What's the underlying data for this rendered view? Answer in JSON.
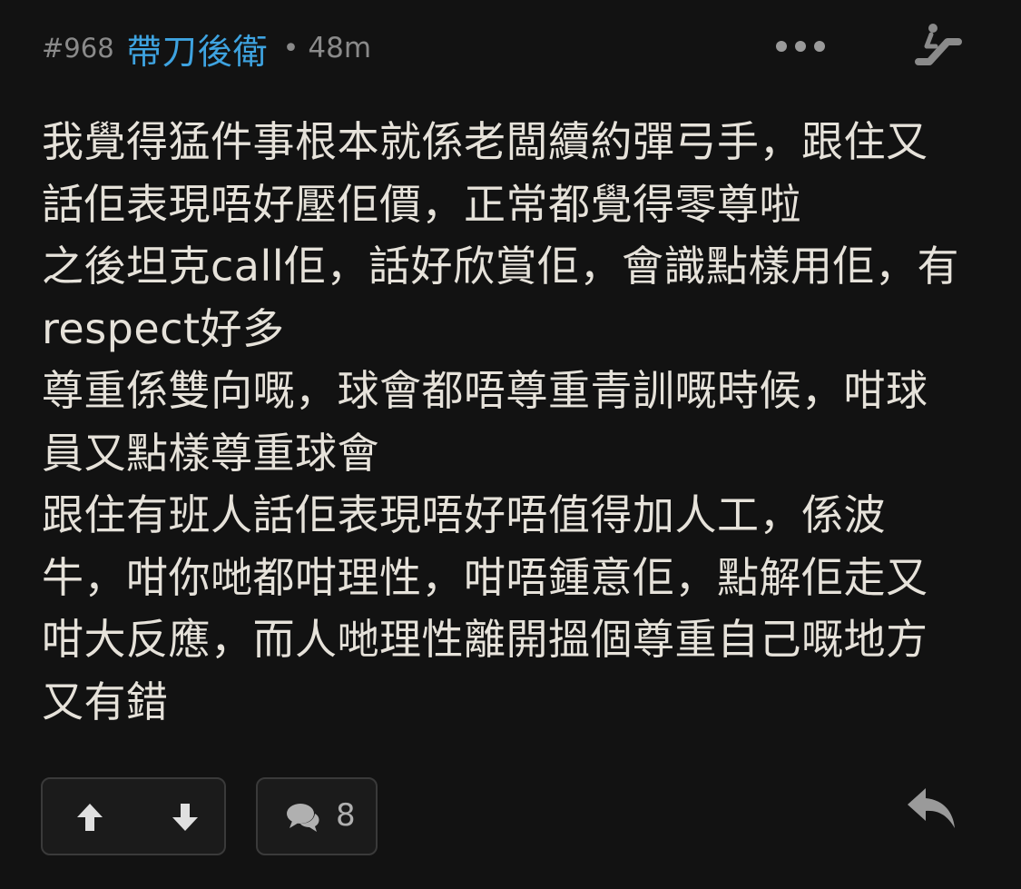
{
  "post": {
    "number": "#968",
    "author": "帶刀後衛",
    "separator": "•",
    "time": "48m"
  },
  "content": {
    "lines": [
      "我覺得猛件事根本就係老闆續約彈弓手，跟住又",
      "話佢表現唔好壓佢價，正常都覺得零尊啦",
      "之後坦克call佢，話好欣賞佢，會識點樣用佢，有",
      "respect好多",
      "尊重係雙向嘅，球會都唔尊重青訓嘅時候，咁球",
      "員又點樣尊重球會",
      "跟住有班人話佢表現唔好唔值得加人工，係波",
      "牛，咁你哋都咁理性，咁唔鍾意佢，點解佢走又",
      "咁大反應，而人哋理性離開搵個尊重自己嘅地方",
      "又有錯"
    ]
  },
  "actions": {
    "comment_count": "8"
  },
  "icons": {
    "more": "more-dots-icon",
    "escalator": "escalator-icon",
    "upvote": "arrow-up-icon",
    "downvote": "arrow-down-icon",
    "comment": "comment-bubbles-icon",
    "reply": "reply-arrow-icon"
  },
  "colors": {
    "background": "#121212",
    "author": "#3ea3e0",
    "text": "#e6e2da",
    "muted": "#8a8a8a",
    "button_border": "#3a3a3a"
  }
}
